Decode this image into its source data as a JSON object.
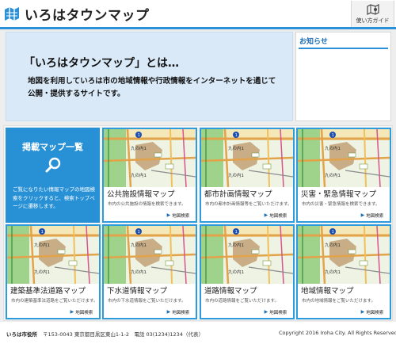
{
  "header": {
    "site_name": "いろはタウンマップ",
    "guide_label": "使い方ガイド"
  },
  "hero": {
    "title": "「いろはタウンマップ」とは…",
    "description": "地図を利用していろは市の地域情報や行政情報をインターネットを通じて公開・提供するサイトです。"
  },
  "news": {
    "title": "お知らせ"
  },
  "catalog": {
    "title": "掲載マップ一覧",
    "description": "ご覧になりたい情報マップの地図検索をクリックすると、検索トップページに遷移します。"
  },
  "map_labels": {
    "station": "九の内1",
    "pin": "1"
  },
  "cards": [
    {
      "title": "公共施設情報マップ",
      "description": "市内の公共施設の情報を検索できます。",
      "button": "地図検索"
    },
    {
      "title": "都市計画情報マップ",
      "description": "市内の都市計画情報等をご覧いただけます。",
      "button": "地図検索"
    },
    {
      "title": "災害・緊急情報マップ",
      "description": "市内の災害・緊急情報を検索できます。",
      "button": "地図検索"
    },
    {
      "title": "建築基準法道路マップ",
      "description": "市内の建築基準法道路をご覧いただけます。",
      "button": "地図検索"
    },
    {
      "title": "下水道情報マップ",
      "description": "市内の下水道情報をご覧いただけます。",
      "button": "地図検索"
    },
    {
      "title": "道路情報マップ",
      "description": "市内の道路情報をご覧いただけます。",
      "button": "地図検索"
    },
    {
      "title": "地域情報マップ",
      "description": "市内の地域情報をご覧いただけます。",
      "button": "地図検索"
    }
  ],
  "footer": {
    "name": "いろは市役所",
    "address": "〒153-0043 東京都目黒区東山1-1-2　電話 03(1234)1234（代表）",
    "copyright": "Copyright 2016 Iroha City. All Rights Reserved."
  },
  "colors": {
    "accent": "#2a90d9",
    "catalog_bg": "#2891d6",
    "hero_bg": "#d9e9f8",
    "card_border": "#2d9bdc"
  }
}
